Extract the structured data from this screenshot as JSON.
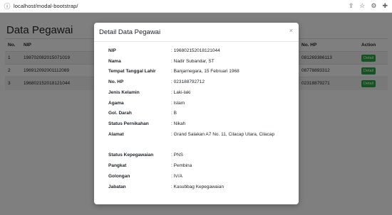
{
  "browser": {
    "url": "localhost/modal-bootstrap/"
  },
  "page": {
    "title": "Data Pegawai",
    "columns": [
      "No.",
      "NIP",
      "No. HP",
      "Action"
    ],
    "rows": [
      {
        "no": "1",
        "nip": "198702082015071019",
        "hp": "081269386113",
        "action": "Detail"
      },
      {
        "no": "2",
        "nip": "196912092001112089",
        "hp": "08778893312",
        "action": "Detail"
      },
      {
        "no": "3",
        "nip": "196802152018121044",
        "hp": "02318879271",
        "action": "Detail"
      }
    ]
  },
  "modal": {
    "title": "Detail Data Pegawai",
    "close": "×",
    "fields": [
      {
        "label": "NIP",
        "value": "196802152018121044"
      },
      {
        "label": "Nama",
        "value": "Nadir Subandar, ST"
      },
      {
        "label": "Tempat Tanggal Lahir",
        "value": "Banjarnegara, 15 Februari 1968"
      },
      {
        "label": "No. HP",
        "value": "023188792712"
      },
      {
        "label": "Jenis Kelamin",
        "value": "Laki-laki"
      },
      {
        "label": "Agama",
        "value": "Islam"
      },
      {
        "label": "Gol. Darah",
        "value": "B"
      },
      {
        "label": "Status Pernikahan",
        "value": "Nikah"
      },
      {
        "label": "Alamat",
        "value": "Grand Salakan A7 No. 11, Cilacap Utara, Cilacap"
      },
      {
        "label": "Status Kepegawaian",
        "value": "PNS"
      },
      {
        "label": "Pangkat",
        "value": "Pembina"
      },
      {
        "label": "Golongan",
        "value": "IV/A"
      },
      {
        "label": "Jabatan",
        "value": "Kasubbag Kepegawaian"
      }
    ]
  }
}
